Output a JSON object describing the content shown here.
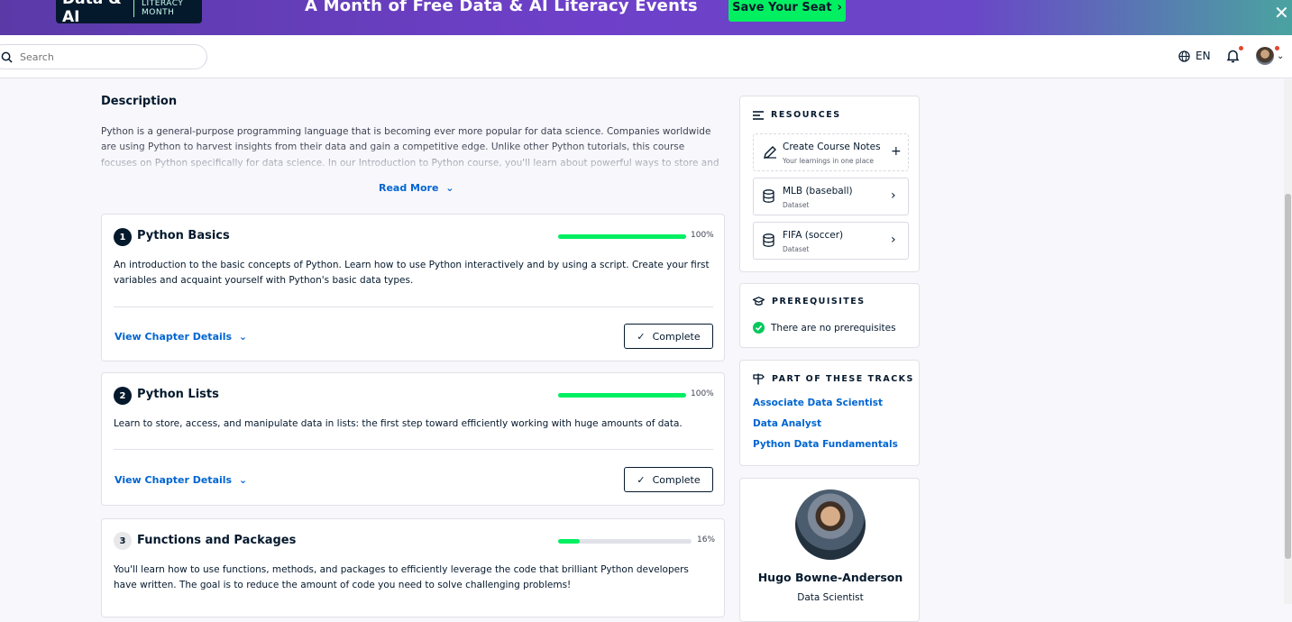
{
  "banner": {
    "logo_text": "Data & AI",
    "logo_sub": "LITERACY MONTH",
    "title": "A Month of Free Data & AI Literacy Events",
    "cta": "Save Your Seat",
    "close": "✕"
  },
  "topbar": {
    "search_placeholder": "Search",
    "language": "EN"
  },
  "description": {
    "heading": "Description",
    "text": "Python is a general-purpose programming language that is becoming ever more popular for data science. Companies worldwide are using Python to harvest insights from their data and gain a competitive edge. Unlike other Python tutorials, this course focuses on Python specifically for data science. In our Introduction to Python course, you'll learn about powerful ways to store and",
    "read_more": "Read More"
  },
  "chapters": [
    {
      "number": "1",
      "title": "Python Basics",
      "progress_percent": 100,
      "progress_label": "100%",
      "description": "An introduction to the basic concepts of Python. Learn how to use Python interactively and by using a script. Create your first variables and acquaint yourself with Python's basic data types.",
      "details_label": "View Chapter Details",
      "status_label": "Complete"
    },
    {
      "number": "2",
      "title": "Python Lists",
      "progress_percent": 100,
      "progress_label": "100%",
      "description": "Learn to store, access, and manipulate data in lists: the first step toward efficiently working with huge amounts of data.",
      "details_label": "View Chapter Details",
      "status_label": "Complete"
    },
    {
      "number": "3",
      "title": "Functions and Packages",
      "progress_percent": 16,
      "progress_label": "16%",
      "description": "You'll learn how to use functions, methods, and packages to efficiently leverage the code that brilliant Python developers have written. The goal is to reduce the amount of code you need to solve challenging problems!"
    }
  ],
  "resources": {
    "heading": "RESOURCES",
    "items": [
      {
        "title": "Create Course Notes",
        "subtitle": "Your learnings in one place",
        "icon": "pencil-icon",
        "action": "+"
      },
      {
        "title": "MLB (baseball)",
        "subtitle": "Dataset",
        "icon": "database-icon",
        "action": "›"
      },
      {
        "title": "FIFA (soccer)",
        "subtitle": "Dataset",
        "icon": "database-icon",
        "action": "›"
      }
    ]
  },
  "prerequisites": {
    "heading": "PREREQUISITES",
    "text": "There are no prerequisites"
  },
  "tracks": {
    "heading": "PART OF THESE TRACKS",
    "items": [
      "Associate Data Scientist",
      "Data Analyst",
      "Python Data Fundamentals"
    ]
  },
  "instructor": {
    "name": "Hugo Bowne-Anderson",
    "role": "Data Scientist"
  },
  "colors": {
    "brand_green": "#03ef62",
    "navy": "#05192d",
    "link_blue": "#0065d1",
    "banner_purple": "#6e40c9"
  }
}
